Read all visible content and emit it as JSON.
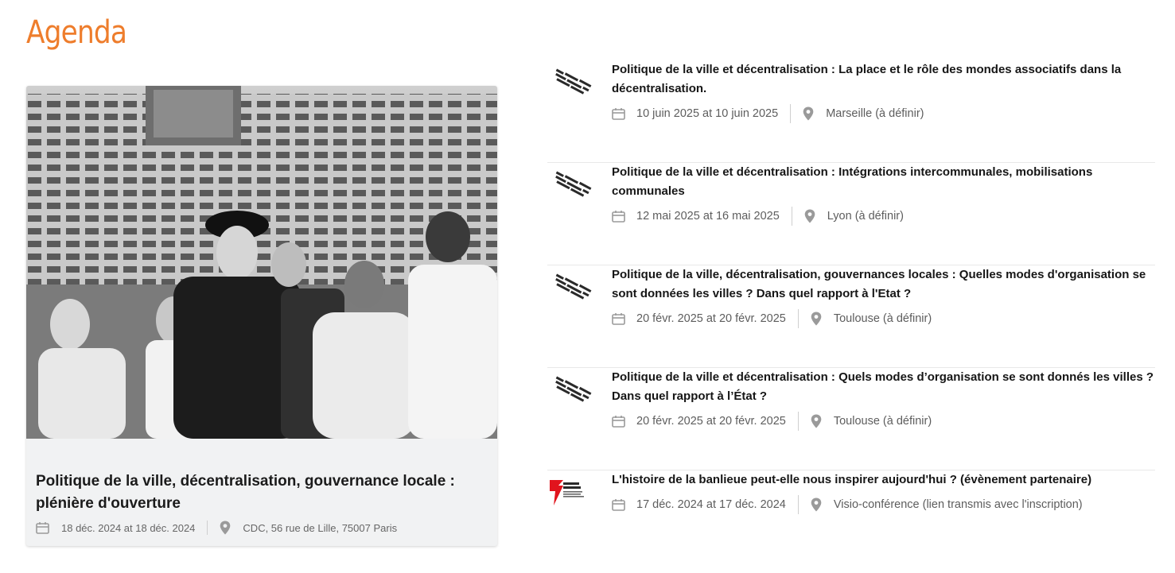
{
  "heading": "Agenda",
  "featured": {
    "title": "Politique de la ville, décentralisation, gouvernance locale : plénière d'ouverture",
    "dates": "18 déc. 2024 at 18 déc. 2024",
    "location": "CDC, 56 rue de Lille, 75007 Paris"
  },
  "events": [
    {
      "title": "Politique de la ville et décentralisation : La place et le rôle des mondes associatifs dans la décentralisation.",
      "dates": "10 juin 2025 at 10 juin 2025",
      "location": "Marseille (à définir)",
      "logo": "comite-histoire-politique-ville-logo"
    },
    {
      "title": "Politique de la ville et décentralisation : Intégrations intercommunales, mobilisations communales",
      "dates": "12 mai 2025 at 16 mai 2025",
      "location": "Lyon (à définir)",
      "logo": "comite-histoire-politique-ville-logo"
    },
    {
      "title": "Politique de la ville, décentralisation, gouvernances locales : Quelles modes d'organisation se sont données les villes ? Dans quel rapport à l'Etat ?",
      "dates": "20 févr. 2025 at 20 févr. 2025",
      "location": "Toulouse (à définir)",
      "logo": "comite-histoire-politique-ville-logo"
    },
    {
      "title": "Politique de la ville et décentralisation : Quels modes d’organisation se sont donnés les villes ? Dans quel rapport à l’État ?",
      "dates": "20 févr. 2025 at 20 févr. 2025",
      "location": "Toulouse (à définir)",
      "logo": "comite-histoire-politique-ville-logo"
    },
    {
      "title": "L'histoire de la banlieue peut-elle nous inspirer aujourd'hui ? (évènement partenaire)",
      "dates": "17 déc. 2024 at 17 déc. 2024",
      "location": "Visio-conférence (lien transmis avec l'inscription)",
      "logo": "trajectoire-ressources-logo"
    }
  ],
  "colors": {
    "accent": "#ee7d2c",
    "card_bg": "#f1f2f3",
    "icon": "#9a9a9a",
    "logo_red": "#e1141d"
  },
  "icons": [
    "calendar-icon",
    "location-pin-icon"
  ]
}
